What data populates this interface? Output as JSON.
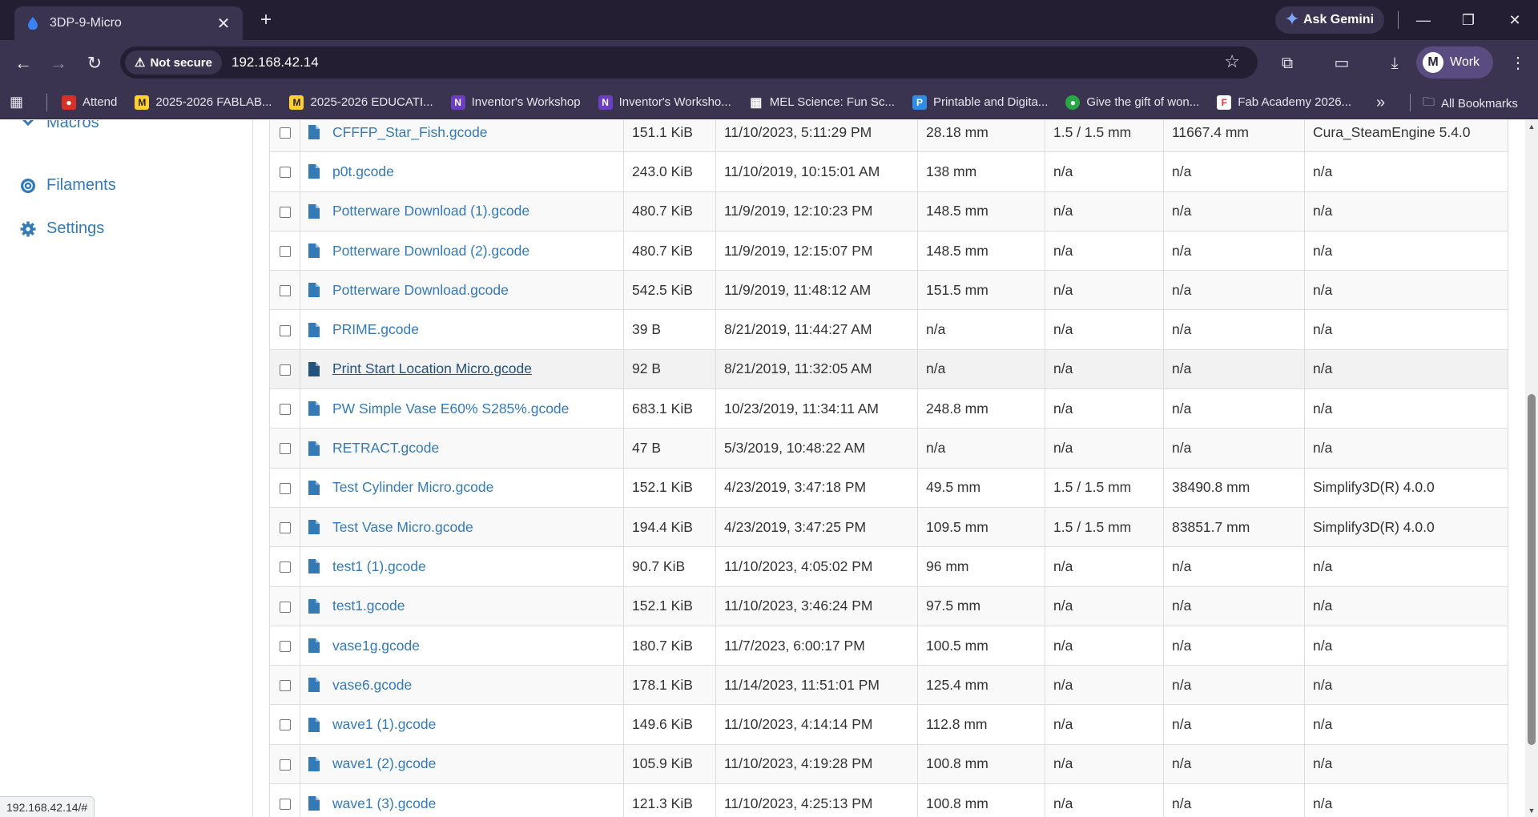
{
  "browser": {
    "tab_title": "3DP-9-Micro",
    "ask_gemini": "Ask Gemini",
    "security_label": "Not secure",
    "url": "192.168.42.14",
    "profile_initial": "M",
    "profile_name": "Work",
    "bookmarks": [
      {
        "label": "Attend",
        "icon": "attend-icon",
        "color": "#d93025"
      },
      {
        "label": "2025-2026 FABLAB...",
        "icon": "miro-icon",
        "color": "#ffd02f"
      },
      {
        "label": "2025-2026 EDUCATI...",
        "icon": "miro-icon",
        "color": "#ffd02f"
      },
      {
        "label": "Inventor's Workshop",
        "icon": "workshop-icon",
        "color": "#6c3ec1"
      },
      {
        "label": "Inventor's Worksho...",
        "icon": "workshop-icon",
        "color": "#6c3ec1"
      },
      {
        "label": "MEL Science: Fun Sc...",
        "icon": "grid-icon",
        "color": "#ffffff"
      },
      {
        "label": "Printable and Digita...",
        "icon": "printable-icon",
        "color": "#2e8de6"
      },
      {
        "label": "Give the gift of won...",
        "icon": "gift-icon",
        "color": "#28a745"
      },
      {
        "label": "Fab Academy 2026...",
        "icon": "fab-academy-icon",
        "color": "#e53935"
      }
    ],
    "all_bookmarks": "All Bookmarks"
  },
  "sidebar": {
    "items": [
      {
        "label": "Macros",
        "icon": "macros-icon"
      },
      {
        "label": "Filaments",
        "icon": "filaments-icon"
      },
      {
        "label": "Settings",
        "icon": "gear-icon"
      }
    ]
  },
  "files": [
    {
      "name": "CFFFP_Star_Fish.gcode",
      "size": "151.1 KiB",
      "modified": "11/10/2023, 5:11:29 PM",
      "height": "28.18 mm",
      "layer": "1.5 / 1.5 mm",
      "filament": "11667.4 mm",
      "generator": "Cura_SteamEngine 5.4.0"
    },
    {
      "name": "p0t.gcode",
      "size": "243.0 KiB",
      "modified": "11/10/2019, 10:15:01 AM",
      "height": "138 mm",
      "layer": "n/a",
      "filament": "n/a",
      "generator": "n/a"
    },
    {
      "name": "Potterware Download (1).gcode",
      "size": "480.7 KiB",
      "modified": "11/9/2019, 12:10:23 PM",
      "height": "148.5 mm",
      "layer": "n/a",
      "filament": "n/a",
      "generator": "n/a"
    },
    {
      "name": "Potterware Download (2).gcode",
      "size": "480.7 KiB",
      "modified": "11/9/2019, 12:15:07 PM",
      "height": "148.5 mm",
      "layer": "n/a",
      "filament": "n/a",
      "generator": "n/a"
    },
    {
      "name": "Potterware Download.gcode",
      "size": "542.5 KiB",
      "modified": "11/9/2019, 11:48:12 AM",
      "height": "151.5 mm",
      "layer": "n/a",
      "filament": "n/a",
      "generator": "n/a"
    },
    {
      "name": "PRIME.gcode",
      "size": "39 B",
      "modified": "8/21/2019, 11:44:27 AM",
      "height": "n/a",
      "layer": "n/a",
      "filament": "n/a",
      "generator": "n/a"
    },
    {
      "name": "Print Start Location Micro.gcode",
      "size": "92 B",
      "modified": "8/21/2019, 11:32:05 AM",
      "height": "n/a",
      "layer": "n/a",
      "filament": "n/a",
      "generator": "n/a"
    },
    {
      "name": "PW Simple Vase E60% S285%.gcode",
      "size": "683.1 KiB",
      "modified": "10/23/2019, 11:34:11 AM",
      "height": "248.8 mm",
      "layer": "n/a",
      "filament": "n/a",
      "generator": "n/a"
    },
    {
      "name": "RETRACT.gcode",
      "size": "47 B",
      "modified": "5/3/2019, 10:48:22 AM",
      "height": "n/a",
      "layer": "n/a",
      "filament": "n/a",
      "generator": "n/a"
    },
    {
      "name": "Test Cylinder Micro.gcode",
      "size": "152.1 KiB",
      "modified": "4/23/2019, 3:47:18 PM",
      "height": "49.5 mm",
      "layer": "1.5 / 1.5 mm",
      "filament": "38490.8 mm",
      "generator": "Simplify3D(R) 4.0.0"
    },
    {
      "name": "Test Vase Micro.gcode",
      "size": "194.4 KiB",
      "modified": "4/23/2019, 3:47:25 PM",
      "height": "109.5 mm",
      "layer": "1.5 / 1.5 mm",
      "filament": "83851.7 mm",
      "generator": "Simplify3D(R) 4.0.0"
    },
    {
      "name": "test1 (1).gcode",
      "size": "90.7 KiB",
      "modified": "11/10/2023, 4:05:02 PM",
      "height": "96 mm",
      "layer": "n/a",
      "filament": "n/a",
      "generator": "n/a"
    },
    {
      "name": "test1.gcode",
      "size": "152.1 KiB",
      "modified": "11/10/2023, 3:46:24 PM",
      "height": "97.5 mm",
      "layer": "n/a",
      "filament": "n/a",
      "generator": "n/a"
    },
    {
      "name": "vase1g.gcode",
      "size": "180.7 KiB",
      "modified": "11/7/2023, 6:00:17 PM",
      "height": "100.5 mm",
      "layer": "n/a",
      "filament": "n/a",
      "generator": "n/a"
    },
    {
      "name": "vase6.gcode",
      "size": "178.1 KiB",
      "modified": "11/14/2023, 11:51:01 PM",
      "height": "125.4 mm",
      "layer": "n/a",
      "filament": "n/a",
      "generator": "n/a"
    },
    {
      "name": "wave1 (1).gcode",
      "size": "149.6 KiB",
      "modified": "11/10/2023, 4:14:14 PM",
      "height": "112.8 mm",
      "layer": "n/a",
      "filament": "n/a",
      "generator": "n/a"
    },
    {
      "name": "wave1 (2).gcode",
      "size": "105.9 KiB",
      "modified": "11/10/2023, 4:19:28 PM",
      "height": "100.8 mm",
      "layer": "n/a",
      "filament": "n/a",
      "generator": "n/a"
    },
    {
      "name": "wave1 (3).gcode",
      "size": "121.3 KiB",
      "modified": "11/10/2023, 4:25:13 PM",
      "height": "100.8 mm",
      "layer": "n/a",
      "filament": "n/a",
      "generator": "n/a"
    }
  ],
  "hovered_row": 6,
  "status_url": "192.168.42.14/#",
  "colors": {
    "link": "#337ab7",
    "chrome_dark": "#241e33",
    "chrome": "#3a3450"
  }
}
